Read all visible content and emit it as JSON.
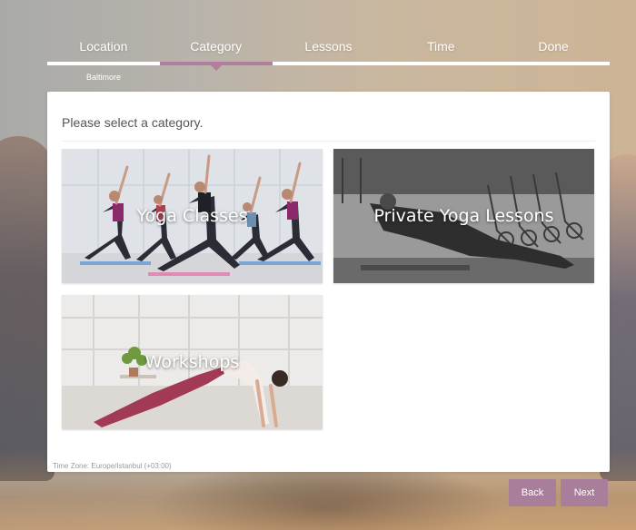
{
  "steps": [
    {
      "label": "Location"
    },
    {
      "label": "Category"
    },
    {
      "label": "Lessons"
    },
    {
      "label": "Time"
    },
    {
      "label": "Done"
    }
  ],
  "active_step": "Category",
  "selected_location": "Baltimore",
  "panel": {
    "title": "Please select a category."
  },
  "categories": [
    {
      "label": "Yoga Classes"
    },
    {
      "label": "Private Yoga Lessons"
    },
    {
      "label": "Workshops"
    }
  ],
  "timezone": "Time Zone: Europe/Istanbul (+03:00)",
  "buttons": {
    "back": "Back",
    "next": "Next"
  },
  "colors": {
    "accent": "#b07fa0",
    "button": "#a97e9b",
    "panel_bg": "#ffffff"
  }
}
